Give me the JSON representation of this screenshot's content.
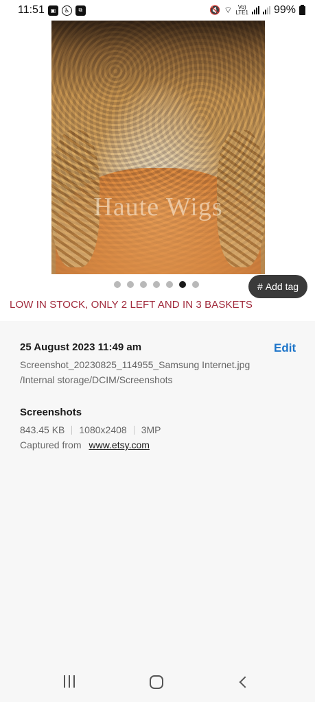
{
  "status_bar": {
    "time": "11:51",
    "battery": "99%",
    "volte_label": "Vo)\nLTE1"
  },
  "photo": {
    "watermark": "Haute Wigs",
    "page_indicator": {
      "count": 7,
      "current": 6
    }
  },
  "add_tag": {
    "label": "Add tag",
    "icon": "#"
  },
  "product": {
    "stock_notice": "LOW IN STOCK, ONLY 2 LEFT AND IN 3 BASKETS"
  },
  "details": {
    "date_time": "25 August 2023 11:49 am",
    "edit_label": "Edit",
    "filename": "Screenshot_20230825_114955_Samsung Internet.jpg",
    "path": "/Internal storage/DCIM/Screenshots",
    "album": "Screenshots",
    "file_size": "843.45 KB",
    "resolution": "1080x2408",
    "megapixels": "3MP",
    "captured_from_label": "Captured from",
    "captured_from_url": "www.etsy.com"
  },
  "colors": {
    "stock_red": "#a0283a",
    "edit_blue": "#1c74c9",
    "panel_bg": "#f7f7f7"
  }
}
